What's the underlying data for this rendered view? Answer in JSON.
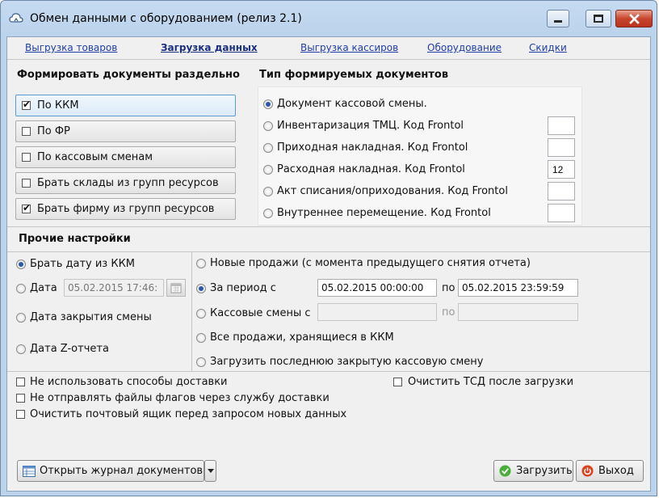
{
  "window": {
    "title": "Обмен данными с оборудованием (релиз 2.1)",
    "icon": "cloud-icon",
    "controls": [
      "minimize-icon",
      "maximize-icon",
      "close-icon"
    ]
  },
  "nav": {
    "links": [
      "Выгрузка товаров",
      "Загрузка данных",
      "Выгрузка кассиров",
      "Оборудование",
      "Скидки"
    ],
    "active_index": 1
  },
  "form_docs": {
    "title": "Формировать документы раздельно",
    "options": [
      {
        "label": "По ККМ",
        "checked": true
      },
      {
        "label": "По ФР",
        "checked": false
      },
      {
        "label": "По кассовым сменам",
        "checked": false
      },
      {
        "label": "Брать склады из групп ресурсов",
        "checked": false
      },
      {
        "label": "Брать фирму из групп ресурсов",
        "checked": true
      }
    ]
  },
  "doc_types": {
    "title": "Тип формируемых документов",
    "options": [
      {
        "label": "Документ кассовой смены.",
        "selected": true,
        "code": null
      },
      {
        "label": "Инвентаризация ТМЦ. Код Frontol",
        "selected": false,
        "code": ""
      },
      {
        "label": "Приходная накладная. Код Frontol",
        "selected": false,
        "code": ""
      },
      {
        "label": "Расходная накладная. Код Frontol",
        "selected": false,
        "code": "12"
      },
      {
        "label": "Акт списания/оприходования. Код Frontol",
        "selected": false,
        "code": ""
      },
      {
        "label": "Внутреннее перемещение. Код Frontol",
        "selected": false,
        "code": ""
      }
    ]
  },
  "other": {
    "title": "Прочие настройки",
    "date_options": [
      {
        "label": "Брать дату из ККМ",
        "selected": true
      },
      {
        "label": "Дата",
        "selected": false
      },
      {
        "label": "Дата закрытия смены",
        "selected": false
      },
      {
        "label": "Дата Z-отчета",
        "selected": false
      }
    ],
    "date_value": "05.02.2015 17:46:",
    "calendar_icon": "calendar-icon",
    "period_options": [
      {
        "label": "Новые продажи (с момента предыдущего снятия отчета)",
        "selected": false
      },
      {
        "label": "За период с",
        "selected": true
      },
      {
        "label": "Кассовые смены с",
        "selected": false
      },
      {
        "label": "Все продажи, хранящиеся в ККМ",
        "selected": false
      },
      {
        "label": "Загрузить последнюю закрытую кассовую смену",
        "selected": false
      }
    ],
    "period_from": "05.02.2015 00:00:00",
    "period_to": "05.02.2015 23:59:59",
    "po_label": "по",
    "shift_from": "",
    "shift_to": ""
  },
  "checks": [
    {
      "label": "Не использовать способы доставки",
      "checked": false
    },
    {
      "label": "Не отправлять файлы флагов через службу доставки",
      "checked": false
    },
    {
      "label": "Очистить почтовый ящик перед запросом новых данных",
      "checked": false
    },
    {
      "label": "Очистить ТСД после загрузки",
      "checked": false
    }
  ],
  "buttons": {
    "journal": "Открыть журнал документов",
    "load": "Загрузить",
    "exit": "Выход",
    "journal_icon": "table-icon",
    "load_icon": "check-circle-icon",
    "exit_icon": "power-icon",
    "dropdown_icon": "chevron-down-icon"
  }
}
